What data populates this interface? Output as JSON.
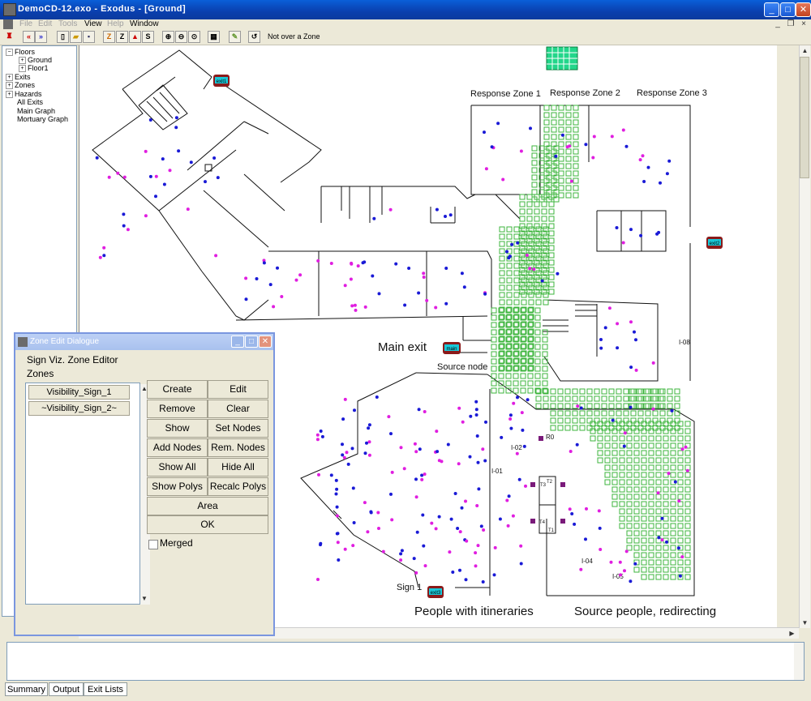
{
  "window": {
    "title": "DemoCD-12.exo - Exodus - [Ground]"
  },
  "menubar": {
    "items": [
      {
        "label": "File",
        "enabled": false
      },
      {
        "label": "Edit",
        "enabled": false
      },
      {
        "label": "Tools",
        "enabled": false
      },
      {
        "label": "View",
        "enabled": true
      },
      {
        "label": "Help",
        "enabled": false
      },
      {
        "label": "Window",
        "enabled": true
      }
    ]
  },
  "toolbar": {
    "status_text": "Not over a Zone"
  },
  "tree": {
    "floors": "Floors",
    "ground": "Ground",
    "floor1": "Floor1",
    "exits": "Exits",
    "zones": "Zones",
    "hazards": "Hazards",
    "all_exits": "All Exits",
    "main_graph": "Main Graph",
    "mortuary_graph": "Mortuary Graph"
  },
  "canvas": {
    "labels": {
      "rz1": "Response Zone 1",
      "rz2": "Response Zone 2",
      "rz3": "Response Zone 3",
      "main_exit": "Main exit",
      "source_node": "Source node",
      "people_itineraries": "People with itineraries",
      "source_people": "Source people, redirecting",
      "sign1": "Sign 1"
    },
    "exits": {
      "exit1": "exit1",
      "exit2": "exit2",
      "main": "main",
      "exit3": "exit3"
    },
    "node_labels": {
      "i01": "I-01",
      "i02": "I-02",
      "i04": "I-04",
      "i05": "I-05",
      "i08": "I-08",
      "r0": "R0",
      "t1": "T1",
      "t2": "T2",
      "t3": "T3",
      "t4": "T4"
    },
    "colors": {
      "person_blue": "#1a1ad6",
      "person_magenta": "#e01ee0",
      "zone_green": "#3cb43c",
      "exit_fill": "#8b1a1a",
      "exit_label": "#19c8d8"
    }
  },
  "dialog": {
    "title": "Zone Edit Dialogue",
    "heading": "Sign Viz. Zone Editor",
    "zones_label": "Zones",
    "zones": [
      "Visibility_Sign_1",
      "~Visibility_Sign_2~"
    ],
    "buttons": {
      "create": "Create",
      "edit": "Edit",
      "remove": "Remove",
      "clear": "Clear",
      "show": "Show",
      "set_nodes": "Set Nodes",
      "add_nodes": "Add Nodes",
      "rem_nodes": "Rem. Nodes",
      "show_all": "Show All",
      "hide_all": "Hide All",
      "show_polys": "Show Polys",
      "recalc_polys": "Recalc Polys",
      "area": "Area",
      "ok": "OK"
    },
    "merged_label": "Merged",
    "merged_checked": false
  },
  "tabs": [
    "Summary",
    "Output",
    "Exit Lists"
  ]
}
